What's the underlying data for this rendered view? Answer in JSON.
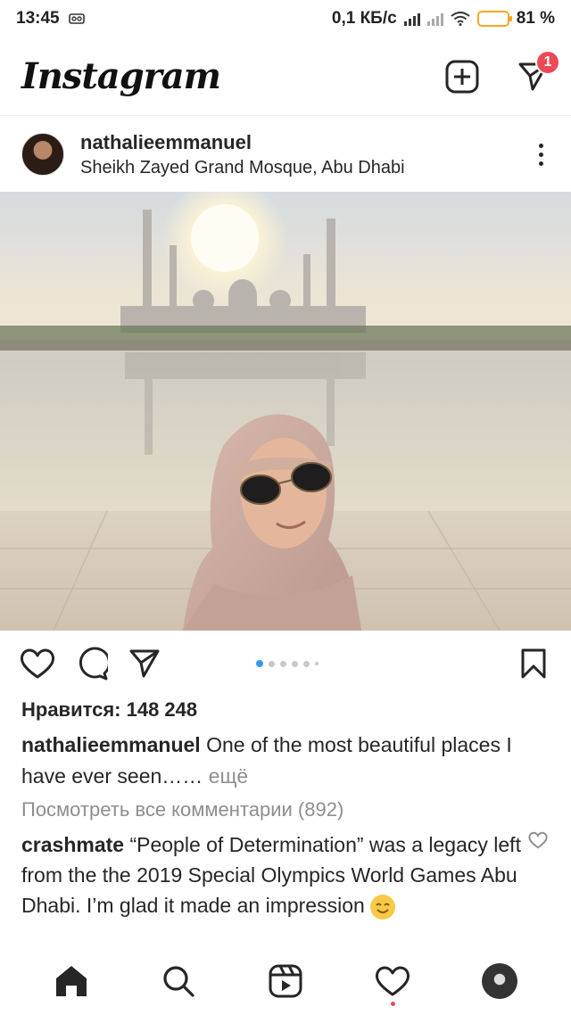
{
  "status_bar": {
    "time": "13:45",
    "network_speed": "0,1 КБ/с",
    "battery_percent": "81 %",
    "battery_level": 0.81,
    "icons": [
      "voicemail-icon",
      "signal-icon",
      "signal-icon",
      "wifi-icon",
      "battery-icon"
    ]
  },
  "header": {
    "logo": "Instagram",
    "new_post_icon": "plus-square-icon",
    "direct_icon": "paper-plane-icon",
    "direct_badge": "1"
  },
  "post": {
    "username": "nathalieemmanuel",
    "location": "Sheikh Zayed Grand Mosque, Abu Dhabi",
    "carousel": {
      "total": 6,
      "current": 1
    },
    "likes": "Нравится: 148 248",
    "caption": {
      "username": "nathalieemmanuel",
      "text": " One of the most beautiful places I have ever seen……",
      "more": " ещё"
    },
    "view_comments": "Посмотреть все комментарии (892)",
    "comment": {
      "username": "crashmate",
      "text": " “People of Determination” was a legacy left from the the 2019 Special Olympics World Games Abu Dhabi. I’m glad it made an impression "
    }
  },
  "bottom_nav": {
    "items": [
      "home-icon",
      "search-icon",
      "reels-icon",
      "heart-icon",
      "profile-avatar"
    ]
  },
  "colors": {
    "accent_blue": "#3897f0",
    "notification_red": "#ed4956",
    "battery_yellow": "#f5b700"
  }
}
